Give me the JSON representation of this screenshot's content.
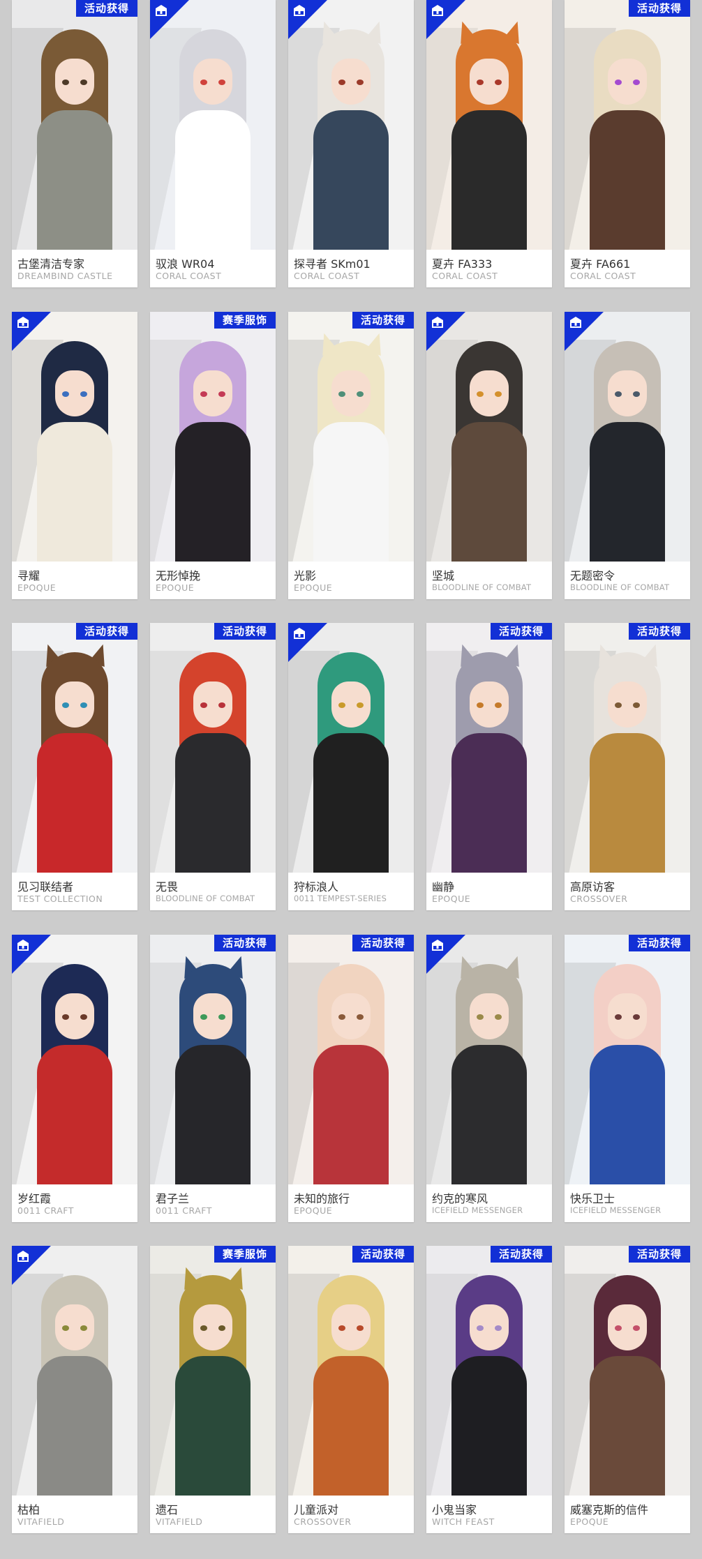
{
  "tag_colors": {
    "event": "#1230d6",
    "season": "#1230d6",
    "corner": "#1230d6"
  },
  "tags": {
    "event": "活动获得",
    "season": "赛季服饰"
  },
  "rows": [
    {
      "cards": [
        {
          "name": "古堡清洁专家",
          "series": "DREAMBIND CASTLE",
          "tag": "event",
          "corner": false,
          "bg": "#e9e9ea",
          "hair": "#7a5a36",
          "outfit": "#8d8f86",
          "eye": "#4d3a28",
          "ears": ""
        },
        {
          "name": "驭浪 WR04",
          "series": "CORAL COAST",
          "tag": "",
          "corner": true,
          "bg": "#eef0f4",
          "hair": "#d6d6dc",
          "outfit": "#ffffff",
          "eye": "#d0423c",
          "ears": ""
        },
        {
          "name": "探寻者 SKm01",
          "series": "CORAL COAST",
          "tag": "",
          "corner": true,
          "bg": "#f2f2f2",
          "hair": "#e8e4de",
          "outfit": "#36475c",
          "eye": "#9b3a2a",
          "ears": "#e8e4de"
        },
        {
          "name": "夏卉 FA333",
          "series": "CORAL COAST",
          "tag": "",
          "corner": true,
          "bg": "#f4ede6",
          "hair": "#d9772f",
          "outfit": "#2a2a2a",
          "eye": "#a9382a",
          "ears": "#d9772f"
        },
        {
          "name": "夏卉 FA661",
          "series": "CORAL COAST",
          "tag": "event",
          "corner": false,
          "bg": "#f3efe8",
          "hair": "#e9dcc2",
          "outfit": "#5a3c2e",
          "eye": "#a44ad0",
          "ears": ""
        }
      ]
    },
    {
      "cards": [
        {
          "name": "寻耀",
          "series": "EPOQUE",
          "tag": "",
          "corner": true,
          "bg": "#f4f2ee",
          "hair": "#1f2a44",
          "outfit": "#efe9dc",
          "eye": "#3b6fbf",
          "ears": ""
        },
        {
          "name": "无形悼挽",
          "series": "EPOQUE",
          "tag": "season",
          "corner": false,
          "bg": "#efeef2",
          "hair": "#c6a6dc",
          "outfit": "#242126",
          "eye": "#c43a55",
          "ears": ""
        },
        {
          "name": "光影",
          "series": "EPOQUE",
          "tag": "event",
          "corner": false,
          "bg": "#f4f3ef",
          "hair": "#efe6c6",
          "outfit": "#f6f6f6",
          "eye": "#4f8f78",
          "ears": "#efe6c6"
        },
        {
          "name": "坚城",
          "series": "BLOODLINE OF COMBAT",
          "tag": "",
          "corner": true,
          "bg": "#e9e7e4",
          "hair": "#3a3633",
          "outfit": "#5e4a3c",
          "eye": "#d4902c",
          "ears": ""
        },
        {
          "name": "无题密令",
          "series": "BLOODLINE OF COMBAT",
          "tag": "",
          "corner": true,
          "bg": "#eceef0",
          "hair": "#c6bfb6",
          "outfit": "#23262c",
          "eye": "#4b5a6a",
          "ears": ""
        }
      ]
    },
    {
      "cards": [
        {
          "name": "见习联结者",
          "series": "TEST COLLECTION",
          "tag": "event",
          "corner": false,
          "bg": "#f1f2f4",
          "hair": "#6e4a2e",
          "outfit": "#c8282a",
          "eye": "#2f8fb5",
          "ears": "#6e4a2e"
        },
        {
          "name": "无畏",
          "series": "BLOODLINE OF COMBAT",
          "tag": "event",
          "corner": false,
          "bg": "#eeeeee",
          "hair": "#d4432c",
          "outfit": "#2a2a2d",
          "eye": "#b8323a",
          "ears": ""
        },
        {
          "name": "狩标浪人",
          "series": "0011 TEMPEST-SERIES",
          "tag": "",
          "corner": true,
          "bg": "#ececec",
          "hair": "#2f9a7d",
          "outfit": "#202020",
          "eye": "#c99a2a",
          "ears": ""
        },
        {
          "name": "幽静",
          "series": "EPOQUE",
          "tag": "event",
          "corner": false,
          "bg": "#f0eef0",
          "hair": "#9e9cad",
          "outfit": "#4b2d55",
          "eye": "#c57a2a",
          "ears": "#9e9cad"
        },
        {
          "name": "高原访客",
          "series": "CROSSOVER",
          "tag": "event",
          "corner": false,
          "bg": "#f0efec",
          "hair": "#e7e2dc",
          "outfit": "#b98a3e",
          "eye": "#7c5a36",
          "ears": "#e7e2dc"
        }
      ]
    },
    {
      "cards": [
        {
          "name": "岁红霞",
          "series": "0011 CRAFT",
          "tag": "",
          "corner": true,
          "bg": "#f3f3f3",
          "hair": "#1d2a55",
          "outfit": "#c42b2b",
          "eye": "#6a3a2a",
          "ears": ""
        },
        {
          "name": "君子兰",
          "series": "0011 CRAFT",
          "tag": "event",
          "corner": false,
          "bg": "#edeef0",
          "hair": "#2d4b7a",
          "outfit": "#26262a",
          "eye": "#3e9a5a",
          "ears": "#2d4b7a"
        },
        {
          "name": "未知的旅行",
          "series": "EPOQUE",
          "tag": "event",
          "corner": false,
          "bg": "#f4efeb",
          "hair": "#f1d4c0",
          "outfit": "#b8343a",
          "eye": "#8a5a3a",
          "ears": ""
        },
        {
          "name": "约克的寒风",
          "series": "ICEFIELD MESSENGER",
          "tag": "",
          "corner": true,
          "bg": "#e9e9e9",
          "hair": "#b9b3a6",
          "outfit": "#2c2c2e",
          "eye": "#9a8a4a",
          "ears": "#b9b3a6"
        },
        {
          "name": "快乐卫士",
          "series": "ICEFIELD MESSENGER",
          "tag": "event",
          "corner": false,
          "bg": "#eef2f6",
          "hair": "#f3cfc6",
          "outfit": "#2a4fa8",
          "eye": "#6a3a3a",
          "ears": ""
        }
      ]
    },
    {
      "cards": [
        {
          "name": "枯柏",
          "series": "VITAFIELD",
          "tag": "",
          "corner": true,
          "bg": "#efefef",
          "hair": "#c9c4b6",
          "outfit": "#8a8a86",
          "eye": "#8a8a3a",
          "ears": ""
        },
        {
          "name": "遗石",
          "series": "VITAFIELD",
          "tag": "season",
          "corner": false,
          "bg": "#ecebe6",
          "hair": "#b59a3e",
          "outfit": "#2a4a3a",
          "eye": "#6a5a2a",
          "ears": "#b59a3e"
        },
        {
          "name": "儿童派对",
          "series": "CROSSOVER",
          "tag": "event",
          "corner": false,
          "bg": "#f3f0ea",
          "hair": "#e6cf86",
          "outfit": "#c2612a",
          "eye": "#b84a2a",
          "ears": ""
        },
        {
          "name": "小鬼当家",
          "series": "WITCH FEAST",
          "tag": "event",
          "corner": false,
          "bg": "#ecebee",
          "hair": "#5a3c86",
          "outfit": "#1e1e22",
          "eye": "#a48ac8",
          "ears": ""
        },
        {
          "name": "威塞克斯的信件",
          "series": "EPOQUE",
          "tag": "event",
          "corner": false,
          "bg": "#f0eeec",
          "hair": "#5a2a3a",
          "outfit": "#6a4a3a",
          "eye": "#c4506a",
          "ears": ""
        }
      ]
    }
  ]
}
